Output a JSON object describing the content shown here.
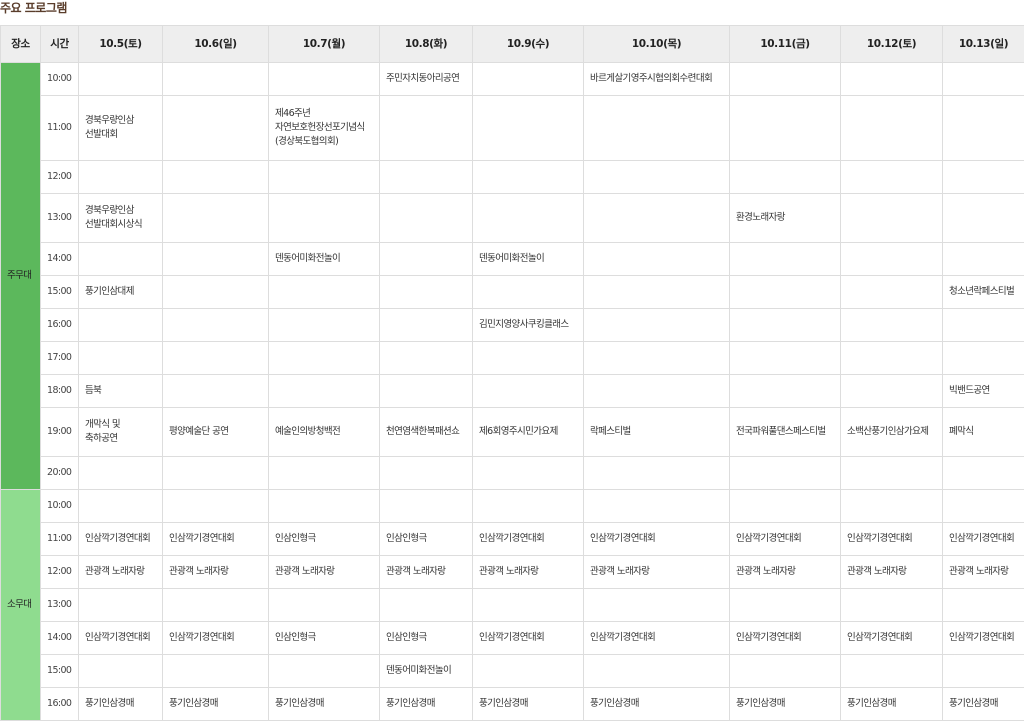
{
  "page_title": "주요 프로그램",
  "header": {
    "venue": "장소",
    "time": "시간",
    "dates": [
      "10.5(토)",
      "10.6(일)",
      "10.7(월)",
      "10.8(화)",
      "10.9(수)",
      "10.10(목)",
      "10.11(금)",
      "10.12(토)",
      "10.13(일)"
    ]
  },
  "venues": [
    "주무대",
    "소무대"
  ],
  "main_stage": [
    {
      "time": "10:00",
      "events": [
        "",
        "",
        "",
        "주민자치동아리공연",
        "",
        "바르게살기영주시협의회수련대회",
        "",
        "",
        ""
      ]
    },
    {
      "time": "11:00",
      "events": [
        "경북우량인삼\n선발대회",
        "",
        "제46주년\n자연보호헌장선포기념식\n(경상북도협의회)",
        "",
        "",
        "",
        "",
        "",
        ""
      ]
    },
    {
      "time": "12:00",
      "events": [
        "",
        "",
        "",
        "",
        "",
        "",
        "",
        "",
        ""
      ]
    },
    {
      "time": "13:00",
      "events": [
        "경북우량인삼\n선발대회시상식",
        "",
        "",
        "",
        "",
        "",
        "환경노래자랑",
        "",
        ""
      ]
    },
    {
      "time": "14:00",
      "events": [
        "",
        "",
        "덴동어미화전놀이",
        "",
        "덴동어미화전놀이",
        "",
        "",
        "",
        ""
      ]
    },
    {
      "time": "15:00",
      "events": [
        "풍기인삼대제",
        "",
        "",
        "",
        "",
        "",
        "",
        "",
        "청소년락페스티벌"
      ]
    },
    {
      "time": "16:00",
      "events": [
        "",
        "",
        "",
        "",
        "김민지영양사쿠킹클래스",
        "",
        "",
        "",
        ""
      ]
    },
    {
      "time": "17:00",
      "events": [
        "",
        "",
        "",
        "",
        "",
        "",
        "",
        "",
        ""
      ]
    },
    {
      "time": "18:00",
      "events": [
        "듬북",
        "",
        "",
        "",
        "",
        "",
        "",
        "",
        "빅밴드공연"
      ]
    },
    {
      "time": "19:00",
      "events": [
        "개막식 및\n축하공연",
        "평양예술단 공연",
        "예술인의방청백전",
        "천연염색한복패션쇼",
        "제6회영주시민가요제",
        "락페스티벌",
        "전국파워풀댄스페스티벌",
        "소백산풍기인삼가요제",
        "폐막식"
      ]
    },
    {
      "time": "20:00",
      "events": [
        "",
        "",
        "",
        "",
        "",
        "",
        "",
        "",
        ""
      ]
    }
  ],
  "small_stage": [
    {
      "time": "10:00",
      "events": [
        "",
        "",
        "",
        "",
        "",
        "",
        "",
        "",
        ""
      ]
    },
    {
      "time": "11:00",
      "events": [
        "인삼깍기경연대회",
        "인삼깍기경연대회",
        "인삼인형극",
        "인삼인형극",
        "인삼깍기경연대회",
        "인삼깍기경연대회",
        "인삼깍기경연대회",
        "인삼깍기경연대회",
        "인삼깍기경연대회"
      ]
    },
    {
      "time": "12:00",
      "events": [
        "관광객 노래자랑",
        "관광객 노래자랑",
        "관광객 노래자랑",
        "관광객 노래자랑",
        "관광객 노래자랑",
        "관광객 노래자랑",
        "관광객 노래자랑",
        "관광객 노래자랑",
        "관광객 노래자랑"
      ]
    },
    {
      "time": "13:00",
      "events": [
        "",
        "",
        "",
        "",
        "",
        "",
        "",
        "",
        ""
      ]
    },
    {
      "time": "14:00",
      "events": [
        "인삼깍기경연대회",
        "인삼깍기경연대회",
        "인삼인형극",
        "인삼인형극",
        "인삼깍기경연대회",
        "인삼깍기경연대회",
        "인삼깍기경연대회",
        "인삼깍기경연대회",
        "인삼깍기경연대회"
      ]
    },
    {
      "time": "15:00",
      "events": [
        "",
        "",
        "",
        "덴동어미화전놀이",
        "",
        "",
        "",
        "",
        ""
      ]
    },
    {
      "time": "16:00",
      "events": [
        "풍기인삼경매",
        "풍기인삼경매",
        "풍기인삼경매",
        "풍기인삼경매",
        "풍기인삼경매",
        "풍기인삼경매",
        "풍기인삼경매",
        "풍기인삼경매",
        "풍기인삼경매"
      ]
    }
  ]
}
